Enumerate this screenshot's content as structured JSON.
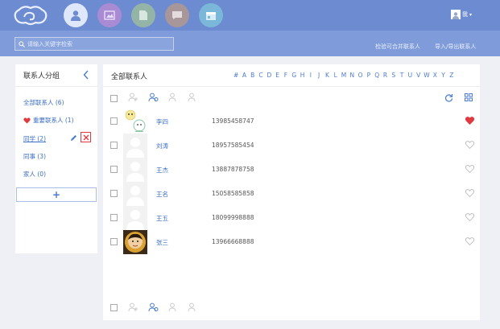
{
  "topbar": {
    "nav": [
      {
        "icon": "contacts-icon",
        "active": true
      },
      {
        "icon": "photo-icon",
        "active": false
      },
      {
        "icon": "file-icon",
        "active": false
      },
      {
        "icon": "message-icon",
        "active": false
      },
      {
        "icon": "calendar-icon",
        "active": false
      }
    ],
    "user_label": "我"
  },
  "subbar": {
    "search_placeholder": "请输入关键字检索",
    "merge_link": "检验可合并联系人",
    "import_export_link": "导入/导出联系人"
  },
  "groups": {
    "title": "联系人分组",
    "items": [
      {
        "label": "全部联系人 (6)",
        "icon": ""
      },
      {
        "label": "重要联系人 (1)",
        "icon": "heart-icon"
      },
      {
        "label": "同学 (2)",
        "icon": ""
      },
      {
        "label": "同事 (3)",
        "icon": ""
      },
      {
        "label": "家人 (0)",
        "icon": ""
      }
    ],
    "add_label": "+"
  },
  "contacts": {
    "title": "全部联系人",
    "alphabet": [
      "#",
      "A",
      "B",
      "C",
      "D",
      "E",
      "F",
      "G",
      "H",
      "I",
      "J",
      "K",
      "L",
      "M",
      "N",
      "O",
      "P",
      "Q",
      "R",
      "S",
      "T",
      "U",
      "V",
      "W",
      "X",
      "Y",
      "Z"
    ],
    "rows": [
      {
        "name": "李四",
        "phone": "13985458747",
        "favorite": true,
        "avatar": "cartoon"
      },
      {
        "name": "刘涛",
        "phone": "18957585454",
        "favorite": false,
        "avatar": "default"
      },
      {
        "name": "王杰",
        "phone": "13887878758",
        "favorite": false,
        "avatar": "default"
      },
      {
        "name": "王名",
        "phone": "15058585858",
        "favorite": false,
        "avatar": "default"
      },
      {
        "name": "王五",
        "phone": "18099998888",
        "favorite": false,
        "avatar": "default"
      },
      {
        "name": "张三",
        "phone": "13966668888",
        "favorite": false,
        "avatar": "photo"
      }
    ]
  },
  "colors": {
    "topbar": "#6d8bd0",
    "subbar": "#7f9bd9",
    "link": "#3b6fc6",
    "heart": "#e0393e"
  }
}
